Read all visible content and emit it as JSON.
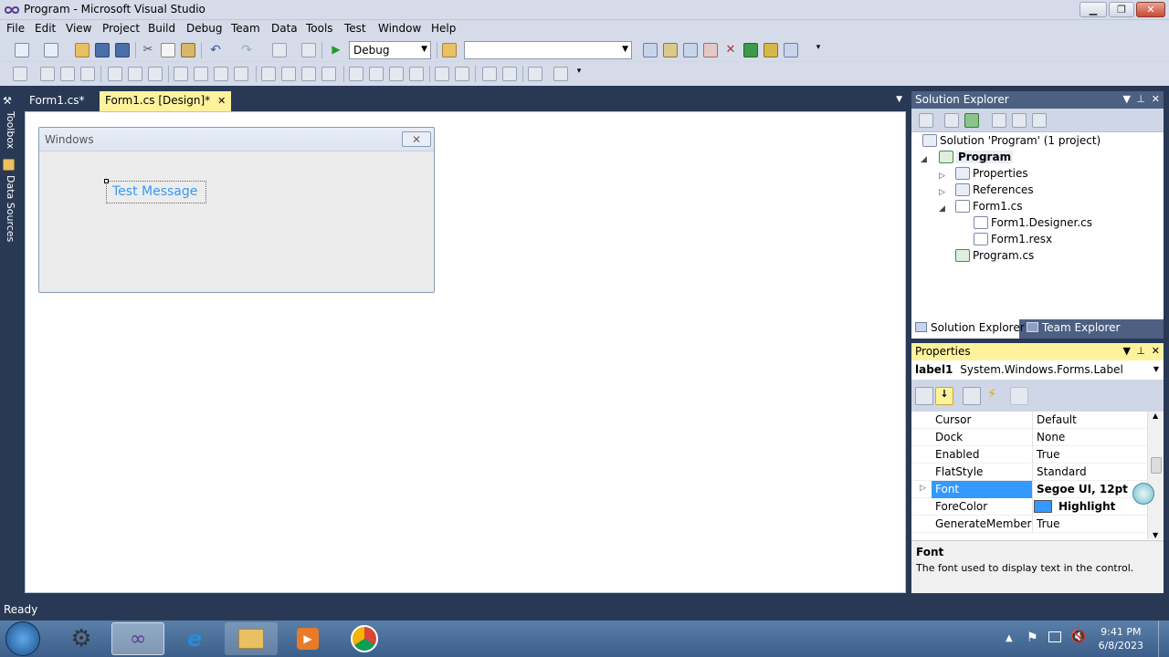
{
  "window": {
    "title": "Program - Microsoft Visual Studio"
  },
  "menu": [
    "File",
    "Edit",
    "View",
    "Project",
    "Build",
    "Debug",
    "Team",
    "Data",
    "Tools",
    "Test",
    "Window",
    "Help"
  ],
  "toolbar": {
    "config_value": "Debug",
    "search_value": ""
  },
  "left_tabs": [
    "Toolbox",
    "Data Sources"
  ],
  "doc_tabs": [
    {
      "label": "Form1.cs*"
    },
    {
      "label": "Form1.cs [Design]*"
    }
  ],
  "form": {
    "title": "Windows",
    "label_text": "Test Message"
  },
  "solution_explorer": {
    "title": "Solution Explorer",
    "items": [
      "Solution 'Program' (1 project)",
      "Program",
      "Properties",
      "References",
      "Form1.cs",
      "Form1.Designer.cs",
      "Form1.resx",
      "Program.cs"
    ],
    "tabs": [
      "Solution Explorer",
      "Team Explorer"
    ]
  },
  "properties": {
    "title": "Properties",
    "object_name": "label1",
    "object_type": "System.Windows.Forms.Label",
    "rows": [
      {
        "name": "Cursor",
        "value": "Default"
      },
      {
        "name": "Dock",
        "value": "None"
      },
      {
        "name": "Enabled",
        "value": "True"
      },
      {
        "name": "FlatStyle",
        "value": "Standard"
      },
      {
        "name": "Font",
        "value": "Segoe UI, 12pt"
      },
      {
        "name": "ForeColor",
        "value": "Highlight"
      },
      {
        "name": "GenerateMember",
        "value": "True"
      }
    ],
    "desc_title": "Font",
    "desc_text": "The font used to display text in the control."
  },
  "status": {
    "text": "Ready"
  },
  "clock": {
    "time": "9:41 PM",
    "date": "6/8/2023"
  },
  "colors": {
    "accent": "#3399ff",
    "chrome": "#293955",
    "panel_header": "#4d6082",
    "active_header": "#fff29d"
  }
}
